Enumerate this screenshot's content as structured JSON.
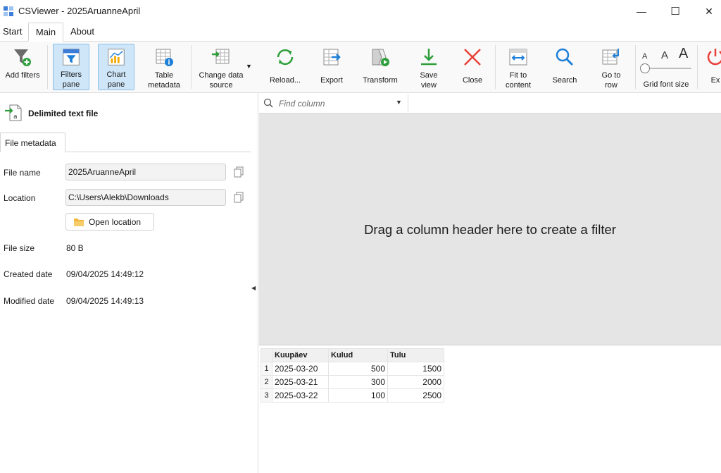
{
  "window": {
    "title": "CSViewer - 2025AruanneApril",
    "minimize_glyph": "—",
    "maximize_glyph": "☐",
    "close_glyph": "✕"
  },
  "menu": {
    "tabs": [
      {
        "label": "Start"
      },
      {
        "label": "Main",
        "active": true
      },
      {
        "label": "About"
      }
    ]
  },
  "ribbon": {
    "buttons": [
      {
        "label": "Add filters",
        "icon": "add-filter-icon"
      },
      {
        "label": "Filters\npane",
        "icon": "filter-pane-icon",
        "selected": true
      },
      {
        "label": "Chart\npane",
        "icon": "chart-pane-icon",
        "selected": true
      },
      {
        "label": "Table\nmetadata",
        "icon": "table-info-icon"
      },
      {
        "label": "Change data\nsource",
        "icon": "change-source-icon",
        "dropdown": true
      },
      {
        "label": "Reload...",
        "icon": "reload-icon"
      },
      {
        "label": "Export",
        "icon": "export-icon"
      },
      {
        "label": "Transform",
        "icon": "transform-icon"
      },
      {
        "label": "Save\nview",
        "icon": "save-icon"
      },
      {
        "label": "Close",
        "icon": "close-icon"
      },
      {
        "label": "Fit to\ncontent",
        "icon": "fit-content-icon"
      },
      {
        "label": "Search",
        "icon": "search-icon"
      },
      {
        "label": "Go to\nrow",
        "icon": "goto-row-icon"
      },
      {
        "label": "Grid font size",
        "icon": "font-size-icon"
      },
      {
        "label": "Ex",
        "icon": "exit-icon"
      }
    ],
    "font_letters": [
      "A",
      "A",
      "A"
    ]
  },
  "left_pane": {
    "header_title": "Delimited text file",
    "tab": "File metadata",
    "fields": {
      "file_name_label": "File name",
      "file_name_value": "2025AruanneApril",
      "location_label": "Location",
      "location_value": "C:\\Users\\Alekb\\Downloads",
      "open_location_label": "Open location",
      "file_size_label": "File size",
      "file_size_value": "80 B",
      "created_label": "Created date",
      "created_value": "09/04/2025 14:49:12",
      "modified_label": "Modified date",
      "modified_value": "09/04/2025 14:49:13"
    }
  },
  "find": {
    "placeholder": "Find column"
  },
  "filter_zone": {
    "text": "Drag a column header here to create a filter"
  },
  "grid": {
    "columns": [
      "Kuupäev",
      "Kulud",
      "Tulu"
    ],
    "rows": [
      {
        "n": "1",
        "date": "2025-03-20",
        "kulud": "500",
        "tulu": "1500"
      },
      {
        "n": "2",
        "date": "2025-03-21",
        "kulud": "300",
        "tulu": "2000"
      },
      {
        "n": "3",
        "date": "2025-03-22",
        "kulud": "100",
        "tulu": "2500"
      }
    ]
  },
  "colors": {
    "selected_bg": "#cfe6f8",
    "accent_blue": "#1e7fd8",
    "green": "#2e9e3b",
    "red": "#e8413b"
  }
}
